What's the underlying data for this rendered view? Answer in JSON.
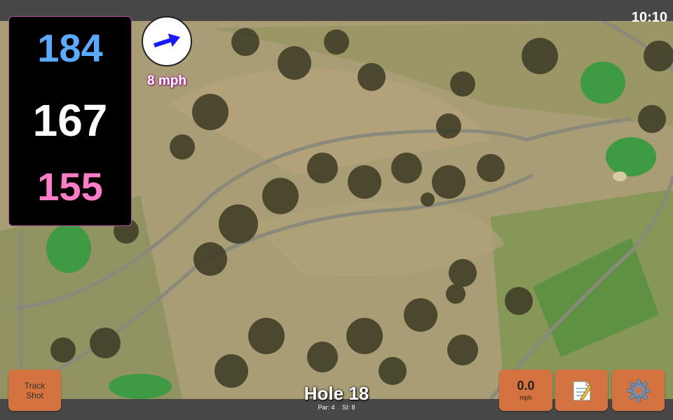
{
  "status_bar": {
    "time": "10:10"
  },
  "distances": {
    "back": "184",
    "middle": "167",
    "front": "155"
  },
  "wind": {
    "speed": "8 mph",
    "direction_icon": "arrow-icon"
  },
  "hole": {
    "title": "Hole 18",
    "par": "Par: 4",
    "stroke_index": "SI: 8"
  },
  "buttons": {
    "track_shot_line1": "Track",
    "track_shot_line2": "Shot",
    "speed_value": "0.0",
    "speed_unit": "mph",
    "notes_icon": "memo-icon",
    "settings_icon": "gear-icon"
  },
  "colors": {
    "back_distance": "#5aabff",
    "middle_distance": "#ffffff",
    "front_distance": "#ff7dc8",
    "button": "#d4733f",
    "wind_arrow": "#1a1aff"
  }
}
